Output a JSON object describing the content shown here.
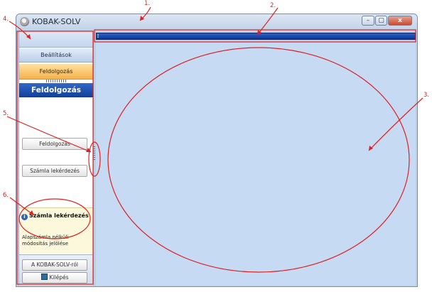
{
  "window": {
    "title": "KOBAK-SOLV",
    "controls": {
      "minimize": "–",
      "maximize": "▢",
      "close": "x"
    }
  },
  "sidebar": {
    "nav": {
      "settings": "Beállítások",
      "processing": "Feldolgozás"
    },
    "section_title": "Feldolgozás",
    "buttons": {
      "processing": "Feldolgozás",
      "invoice_query": "Számla lekérdezés"
    },
    "info": {
      "title": "Számla lekérdezés",
      "text": "Alapszámla nélküli módosítás jelölése"
    },
    "bottom": {
      "about": "A KOBAK-SOLV-ról",
      "exit": "Kilépés"
    }
  },
  "annotations": {
    "labels": [
      "1.",
      "2.",
      "3.",
      "4.",
      "5.",
      "6."
    ],
    "color": "#e02020"
  }
}
